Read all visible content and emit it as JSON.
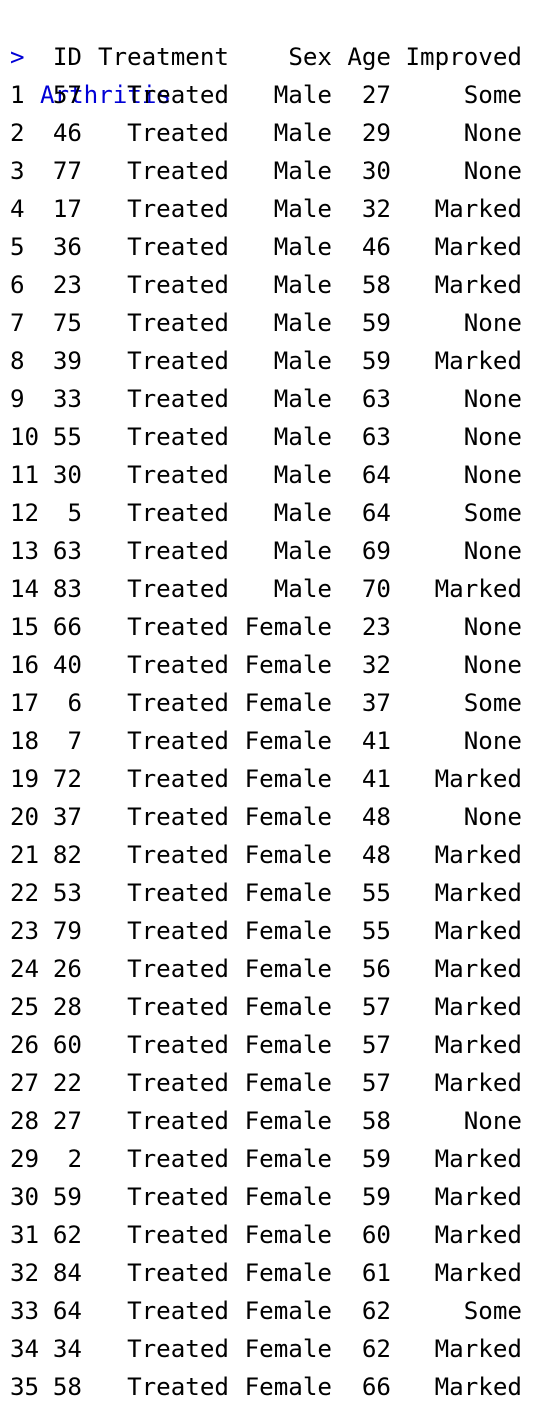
{
  "console": {
    "prompt": ">",
    "command": "Arthritis"
  },
  "table": {
    "headers": [
      "ID",
      "Treatment",
      "Sex",
      "Age",
      "Improved"
    ],
    "rows": [
      {
        "row": "1",
        "id": "57",
        "treatment": "Treated",
        "sex": "Male",
        "age": "27",
        "improved": "Some"
      },
      {
        "row": "2",
        "id": "46",
        "treatment": "Treated",
        "sex": "Male",
        "age": "29",
        "improved": "None"
      },
      {
        "row": "3",
        "id": "77",
        "treatment": "Treated",
        "sex": "Male",
        "age": "30",
        "improved": "None"
      },
      {
        "row": "4",
        "id": "17",
        "treatment": "Treated",
        "sex": "Male",
        "age": "32",
        "improved": "Marked"
      },
      {
        "row": "5",
        "id": "36",
        "treatment": "Treated",
        "sex": "Male",
        "age": "46",
        "improved": "Marked"
      },
      {
        "row": "6",
        "id": "23",
        "treatment": "Treated",
        "sex": "Male",
        "age": "58",
        "improved": "Marked"
      },
      {
        "row": "7",
        "id": "75",
        "treatment": "Treated",
        "sex": "Male",
        "age": "59",
        "improved": "None"
      },
      {
        "row": "8",
        "id": "39",
        "treatment": "Treated",
        "sex": "Male",
        "age": "59",
        "improved": "Marked"
      },
      {
        "row": "9",
        "id": "33",
        "treatment": "Treated",
        "sex": "Male",
        "age": "63",
        "improved": "None"
      },
      {
        "row": "10",
        "id": "55",
        "treatment": "Treated",
        "sex": "Male",
        "age": "63",
        "improved": "None"
      },
      {
        "row": "11",
        "id": "30",
        "treatment": "Treated",
        "sex": "Male",
        "age": "64",
        "improved": "None"
      },
      {
        "row": "12",
        "id": "5",
        "treatment": "Treated",
        "sex": "Male",
        "age": "64",
        "improved": "Some"
      },
      {
        "row": "13",
        "id": "63",
        "treatment": "Treated",
        "sex": "Male",
        "age": "69",
        "improved": "None"
      },
      {
        "row": "14",
        "id": "83",
        "treatment": "Treated",
        "sex": "Male",
        "age": "70",
        "improved": "Marked"
      },
      {
        "row": "15",
        "id": "66",
        "treatment": "Treated",
        "sex": "Female",
        "age": "23",
        "improved": "None"
      },
      {
        "row": "16",
        "id": "40",
        "treatment": "Treated",
        "sex": "Female",
        "age": "32",
        "improved": "None"
      },
      {
        "row": "17",
        "id": "6",
        "treatment": "Treated",
        "sex": "Female",
        "age": "37",
        "improved": "Some"
      },
      {
        "row": "18",
        "id": "7",
        "treatment": "Treated",
        "sex": "Female",
        "age": "41",
        "improved": "None"
      },
      {
        "row": "19",
        "id": "72",
        "treatment": "Treated",
        "sex": "Female",
        "age": "41",
        "improved": "Marked"
      },
      {
        "row": "20",
        "id": "37",
        "treatment": "Treated",
        "sex": "Female",
        "age": "48",
        "improved": "None"
      },
      {
        "row": "21",
        "id": "82",
        "treatment": "Treated",
        "sex": "Female",
        "age": "48",
        "improved": "Marked"
      },
      {
        "row": "22",
        "id": "53",
        "treatment": "Treated",
        "sex": "Female",
        "age": "55",
        "improved": "Marked"
      },
      {
        "row": "23",
        "id": "79",
        "treatment": "Treated",
        "sex": "Female",
        "age": "55",
        "improved": "Marked"
      },
      {
        "row": "24",
        "id": "26",
        "treatment": "Treated",
        "sex": "Female",
        "age": "56",
        "improved": "Marked"
      },
      {
        "row": "25",
        "id": "28",
        "treatment": "Treated",
        "sex": "Female",
        "age": "57",
        "improved": "Marked"
      },
      {
        "row": "26",
        "id": "60",
        "treatment": "Treated",
        "sex": "Female",
        "age": "57",
        "improved": "Marked"
      },
      {
        "row": "27",
        "id": "22",
        "treatment": "Treated",
        "sex": "Female",
        "age": "57",
        "improved": "Marked"
      },
      {
        "row": "28",
        "id": "27",
        "treatment": "Treated",
        "sex": "Female",
        "age": "58",
        "improved": "None"
      },
      {
        "row": "29",
        "id": "2",
        "treatment": "Treated",
        "sex": "Female",
        "age": "59",
        "improved": "Marked"
      },
      {
        "row": "30",
        "id": "59",
        "treatment": "Treated",
        "sex": "Female",
        "age": "59",
        "improved": "Marked"
      },
      {
        "row": "31",
        "id": "62",
        "treatment": "Treated",
        "sex": "Female",
        "age": "60",
        "improved": "Marked"
      },
      {
        "row": "32",
        "id": "84",
        "treatment": "Treated",
        "sex": "Female",
        "age": "61",
        "improved": "Marked"
      },
      {
        "row": "33",
        "id": "64",
        "treatment": "Treated",
        "sex": "Female",
        "age": "62",
        "improved": "Some"
      },
      {
        "row": "34",
        "id": "34",
        "treatment": "Treated",
        "sex": "Female",
        "age": "62",
        "improved": "Marked"
      },
      {
        "row": "35",
        "id": "58",
        "treatment": "Treated",
        "sex": "Female",
        "age": "66",
        "improved": "Marked"
      }
    ]
  },
  "colors": {
    "command": "#0000d6",
    "output": "#000000",
    "background": "#ffffff"
  }
}
